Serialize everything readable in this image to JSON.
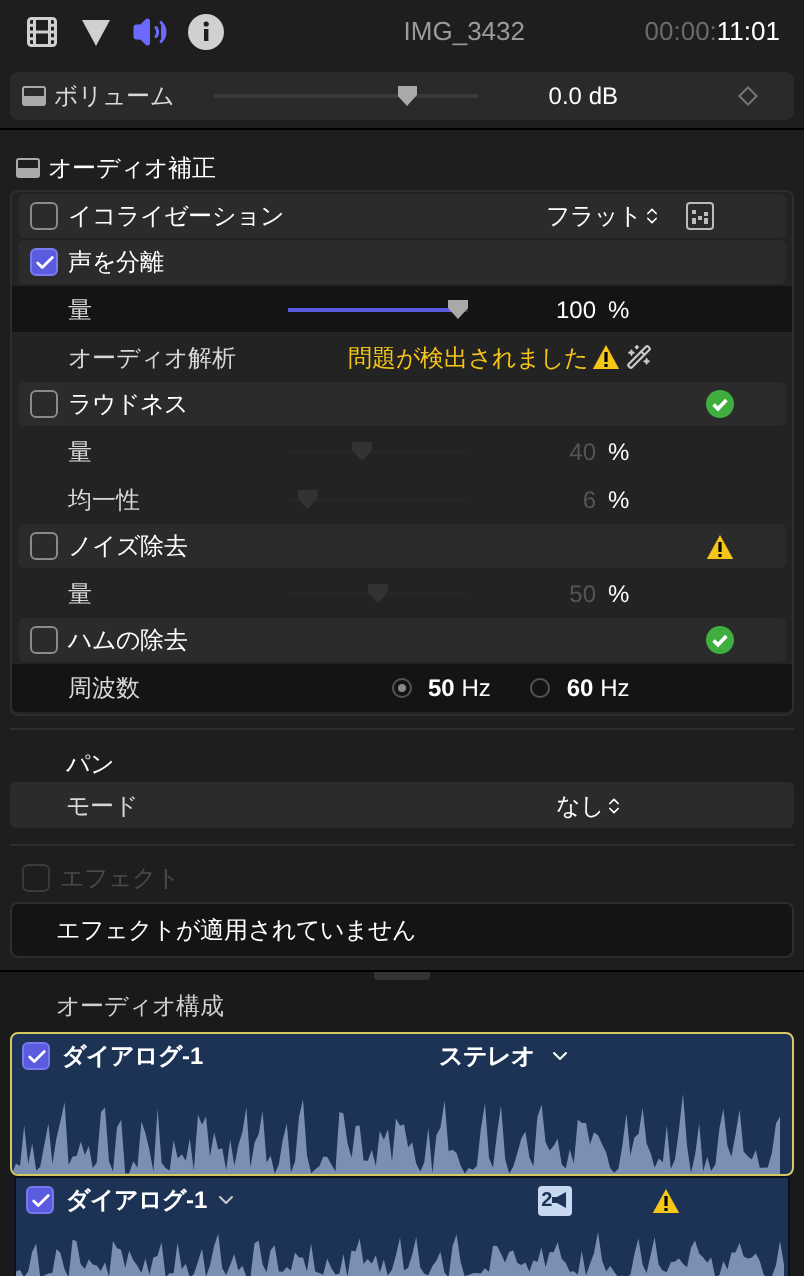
{
  "header": {
    "tabs": [
      {
        "kind": "video",
        "selected": false
      },
      {
        "kind": "color",
        "selected": false
      },
      {
        "kind": "audio",
        "selected": true
      },
      {
        "kind": "info",
        "selected": false
      }
    ],
    "title": "IMG_3432",
    "timecode_dim": "00:00:",
    "timecode": "11:01"
  },
  "volume": {
    "label": "ボリューム",
    "level": 0.75,
    "value": "0.0 dB"
  },
  "enhancement": {
    "title": "オーディオ補正",
    "rows": [
      {
        "kind": "check",
        "label": "イコライゼーション",
        "checked": false,
        "value": "フラット",
        "indicator": {
          "kind": "eq"
        }
      },
      {
        "kind": "check",
        "label": "声を分離",
        "checked": true
      },
      {
        "kind": "slider",
        "label": "量",
        "level": 1.0,
        "value": "100",
        "unit": "%",
        "disabled": false
      },
      {
        "kind": "analysis",
        "label": "オーディオ解析",
        "value": "問題が検出されました"
      },
      {
        "kind": "check",
        "label": "ラウドネス",
        "checked": false,
        "indicator": {
          "kind": "ok"
        }
      },
      {
        "kind": "slider",
        "label": "量",
        "level": 0.4,
        "value": "40",
        "unit": "%",
        "disabled": true
      },
      {
        "kind": "slider",
        "label": "均一性",
        "level": 0.06,
        "value": "6",
        "unit": "%",
        "disabled": true
      },
      {
        "kind": "check",
        "label": "ノイズ除去",
        "checked": false,
        "indicator": {
          "kind": "warning"
        }
      },
      {
        "kind": "slider",
        "label": "量",
        "level": 0.5,
        "value": "50",
        "unit": "%",
        "disabled": true
      },
      {
        "kind": "check",
        "label": "ハムの除去",
        "checked": false,
        "indicator": {
          "kind": "ok"
        }
      },
      {
        "kind": "radio",
        "label": "周波数",
        "options": [
          {
            "value": "50",
            "unit": "Hz",
            "selected": true
          },
          {
            "value": "60",
            "unit": "Hz",
            "selected": false
          }
        ]
      }
    ]
  },
  "pan": {
    "title": "パン",
    "mode_label": "モード",
    "mode_value": "なし"
  },
  "effects": {
    "label": "エフェクト",
    "checked": false,
    "disabled": true,
    "empty_text": "エフェクトが適用されていません"
  },
  "audio_config": {
    "title": "オーディオ構成",
    "components": [
      {
        "label": "ダイアログ-1",
        "checked": true,
        "selected": true,
        "value": "ステレオ"
      },
      {
        "label": "ダイアログ-1",
        "checked": true,
        "selected": false,
        "badge": "2",
        "warning": true
      }
    ]
  }
}
